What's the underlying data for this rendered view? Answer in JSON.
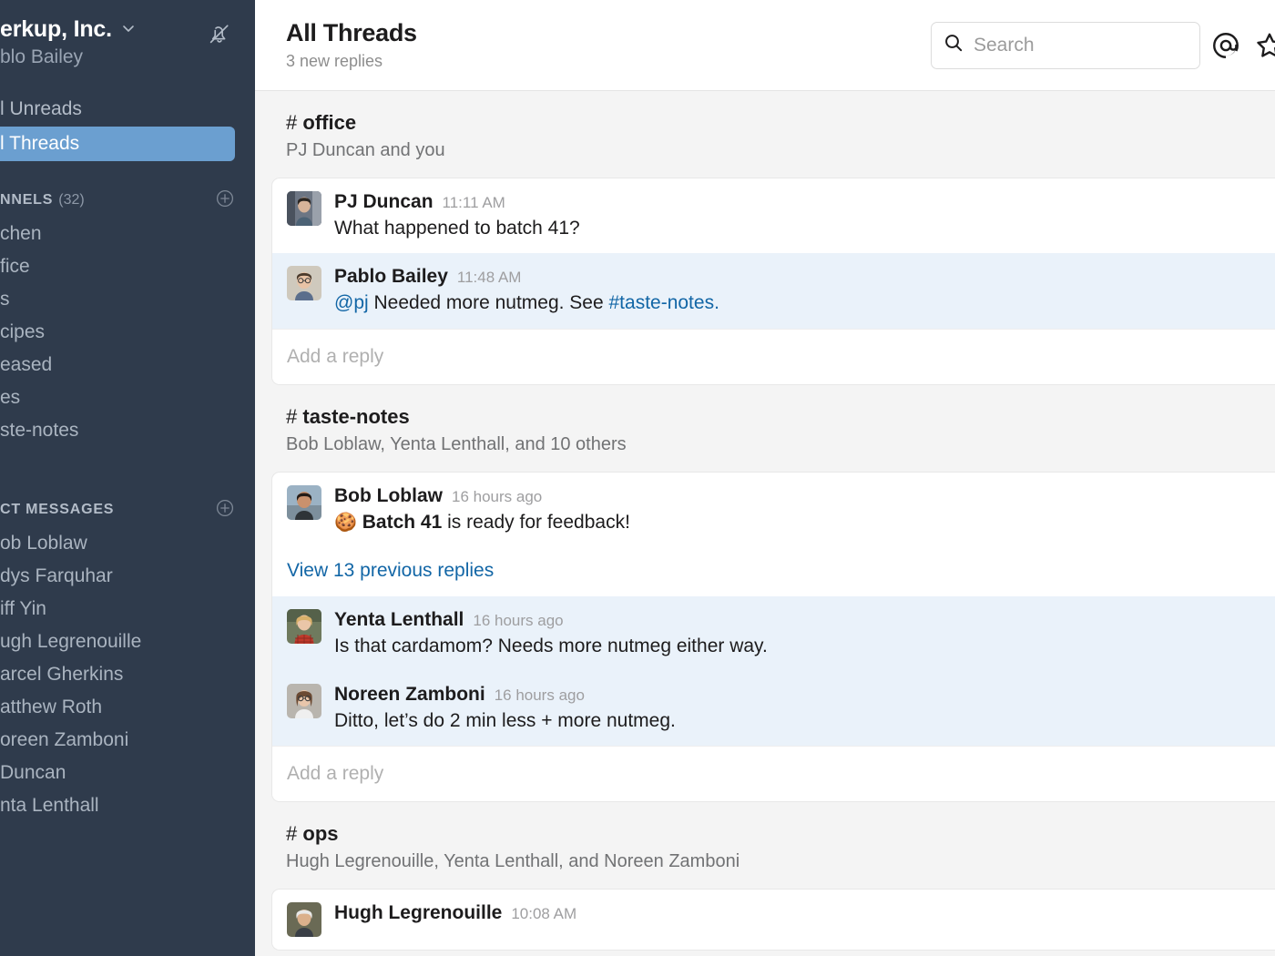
{
  "colors": {
    "sidebar_bg": "#2f3b4c",
    "sidebar_active": "#6b9fd0",
    "unread_highlight": "#eaf2fa",
    "link": "#1266a6",
    "main_bg": "#f4f4f4"
  },
  "sidebar": {
    "workspace_name": "erkup, Inc.",
    "workspace_caret": "chevron-down",
    "user_name": "blo Bailey",
    "notifications_icon": "bell-muted-icon",
    "nav": [
      {
        "label": "l Unreads",
        "active": false
      },
      {
        "label": "l Threads",
        "active": true
      }
    ],
    "channels_section": {
      "label": "NNELS",
      "count": "(32)",
      "add_icon": "plus-circle-icon",
      "items": [
        {
          "label": "chen"
        },
        {
          "label": "fice"
        },
        {
          "label": "s"
        },
        {
          "label": "cipes"
        },
        {
          "label": "eased"
        },
        {
          "label": "es"
        },
        {
          "label": "ste-notes"
        }
      ]
    },
    "dms_section": {
      "label": "CT MESSAGES",
      "add_icon": "plus-circle-icon",
      "items": [
        {
          "label": "ob Loblaw"
        },
        {
          "label": "dys Farquhar"
        },
        {
          "label": "iff Yin"
        },
        {
          "label": "ugh Legrenouille"
        },
        {
          "label": "arcel Gherkins"
        },
        {
          "label": "atthew Roth"
        },
        {
          "label": "oreen Zamboni"
        },
        {
          "label": " Duncan"
        },
        {
          "label": "nta Lenthall"
        }
      ]
    }
  },
  "topbar": {
    "title": "All Threads",
    "subtitle": "3 new replies",
    "search": {
      "placeholder": "Search",
      "value": "",
      "icon": "search-icon"
    },
    "mentions_icon": "at-mention-icon",
    "starred_icon": "star-icon"
  },
  "threads": [
    {
      "channel": "office",
      "hash": "#",
      "members": "PJ Duncan and you",
      "messages": [
        {
          "author": "PJ Duncan",
          "time": "11:11 AM",
          "text": "What happened to batch 41?",
          "unread": false
        },
        {
          "author": "Pablo Bailey",
          "time": "11:48 AM",
          "text_mention": "@pj",
          "text_middle": " Needed more nutmeg. See ",
          "text_link": "#taste-notes.",
          "unread": true
        }
      ],
      "add_reply_placeholder": "Add a reply"
    },
    {
      "channel": "taste-notes",
      "hash": "#",
      "members": "Bob Loblaw, Yenta Lenthall, and 10 others",
      "messages": [
        {
          "author": "Bob Loblaw",
          "time": "16 hours ago",
          "emoji": "🍪",
          "text_bold": "Batch 41",
          "text_rest": " is ready for feedback!",
          "unread": false
        },
        {
          "author": "Yenta Lenthall",
          "time": "16 hours ago",
          "text": "Is that cardamom? Needs more nutmeg either way.",
          "unread": true
        },
        {
          "author": "Noreen Zamboni",
          "time": "16 hours ago",
          "text": "Ditto, let’s do 2 min less + more nutmeg.",
          "unread": true
        }
      ],
      "view_previous": "View 13 previous replies",
      "add_reply_placeholder": "Add a reply"
    },
    {
      "channel": "ops",
      "hash": "#",
      "members": "Hugh Legrenouille, Yenta Lenthall, and Noreen Zamboni",
      "messages": [
        {
          "author": "Hugh Legrenouille",
          "time": "10:08 AM",
          "text": "",
          "unread": false
        }
      ]
    }
  ]
}
